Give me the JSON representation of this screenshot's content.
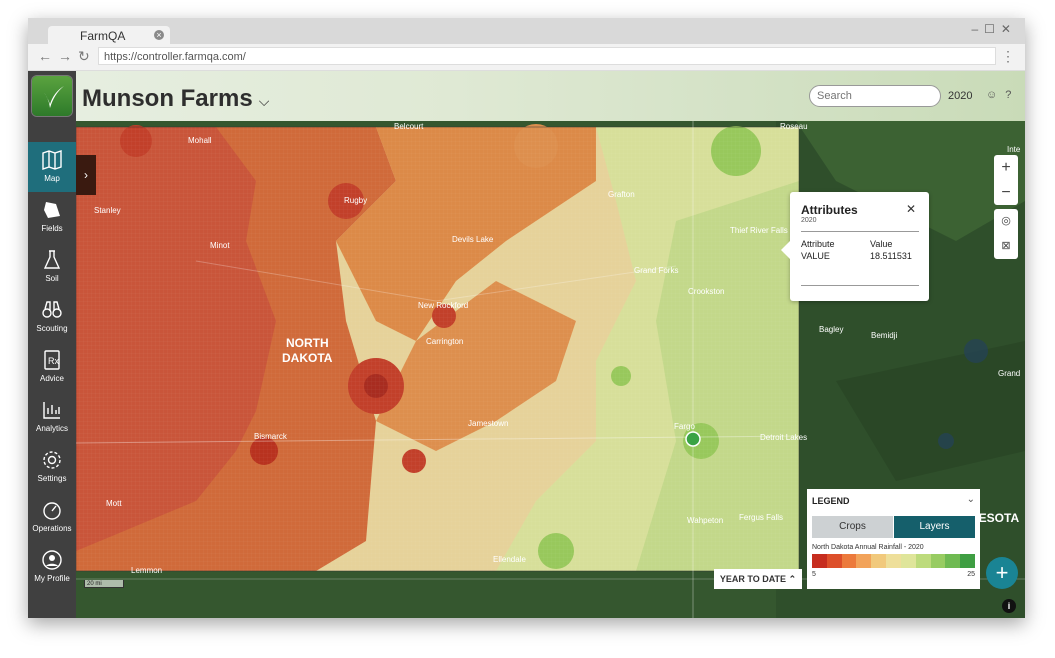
{
  "browser": {
    "tab_title": "FarmQA",
    "url": "https://controller.farmqa.com/"
  },
  "sidebar": {
    "items": [
      {
        "label": "Map",
        "icon": "map-icon",
        "active": true
      },
      {
        "label": "Fields",
        "icon": "fields-icon"
      },
      {
        "label": "Soil",
        "icon": "flask-icon"
      },
      {
        "label": "Scouting",
        "icon": "binoculars-icon"
      },
      {
        "label": "Advice",
        "icon": "prescription-icon"
      },
      {
        "label": "Analytics",
        "icon": "bar-chart-icon"
      },
      {
        "label": "Settings",
        "icon": "gear-icon"
      },
      {
        "label": "Operations",
        "icon": "gauge-icon"
      },
      {
        "label": "My Profile",
        "icon": "user-icon"
      }
    ]
  },
  "header": {
    "farm_name": "Munson Farms",
    "search_placeholder": "Search",
    "year": "2020"
  },
  "map": {
    "labels": [
      "Belcourt",
      "Roseau",
      "Mohall",
      "Stanley",
      "Minot",
      "Rugby",
      "Grafton",
      "Devils Lake",
      "Thief River Falls",
      "Grand Forks",
      "Crookston",
      "New Rockford",
      "Bagley",
      "Bemidji",
      "NORTH",
      "DAKOTA",
      "Carrington",
      "Grand",
      "Bismarck",
      "Jamestown",
      "Fargo",
      "Detroit Lakes",
      "Mott",
      "Wahpeton",
      "Fergus Falls",
      "Ellendale",
      "Lemmon",
      "MINNESOTA",
      "Inte"
    ],
    "scale_label": "20 mi",
    "accent_color": "#1a8494"
  },
  "popup": {
    "title": "Attributes",
    "subtitle": "2020",
    "col1_header": "Attribute",
    "col2_header": "Value",
    "row_label": "VALUE",
    "row_value": "18.511531"
  },
  "legend": {
    "title": "LEGEND",
    "tab_crops": "Crops",
    "tab_layers": "Layers",
    "subtitle": "North Dakota Annual Rainfall - 2020",
    "min": "5",
    "max": "25",
    "colors": [
      "#c62d1f",
      "#dd4f2a",
      "#ec7a3c",
      "#f2a35a",
      "#f1c97c",
      "#eedf9a",
      "#dfe59a",
      "#bddb7c",
      "#98cc62",
      "#6fba52",
      "#3f9e43"
    ]
  },
  "controls": {
    "year_to_date": "YEAR TO DATE"
  }
}
